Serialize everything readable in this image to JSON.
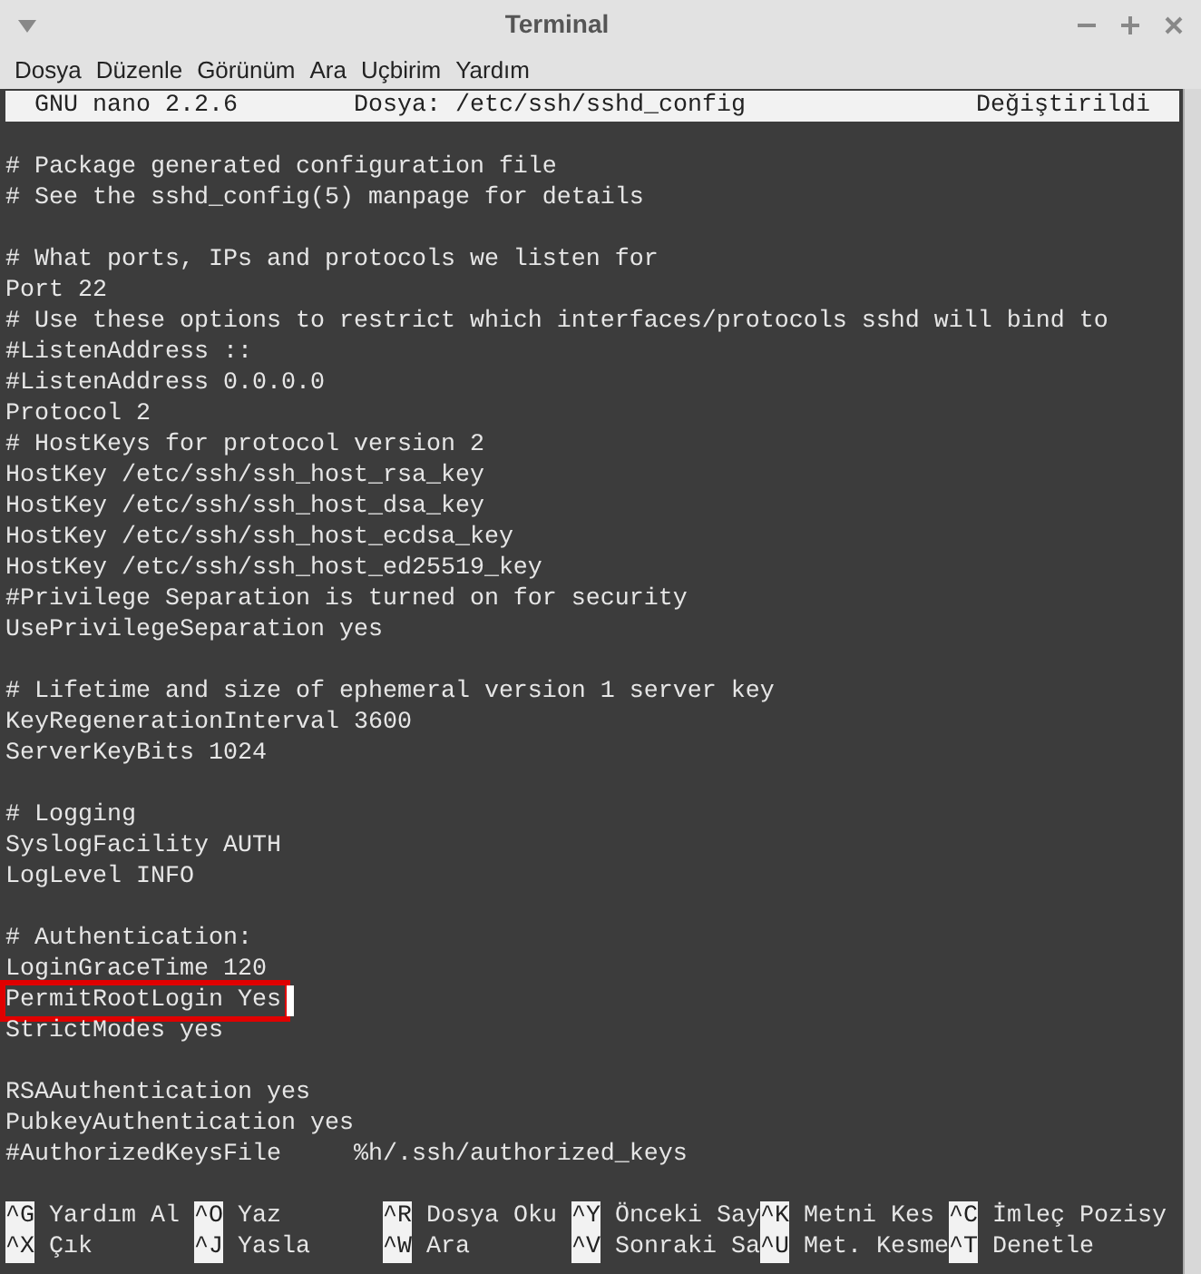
{
  "window": {
    "title": "Terminal"
  },
  "menu": [
    "Dosya",
    "Düzenle",
    "Görünüm",
    "Ara",
    "Uçbirim",
    "Yardım"
  ],
  "nano_header": {
    "version": "GNU nano 2.2.6",
    "file": "Dosya: /etc/ssh/sshd_config",
    "status": "Değiştirildi"
  },
  "lines": [
    {
      "kind": "blank"
    },
    {
      "kind": "text",
      "text": "# Package generated configuration file"
    },
    {
      "kind": "text",
      "text": "# See the sshd_config(5) manpage for details"
    },
    {
      "kind": "blank"
    },
    {
      "kind": "text",
      "text": "# What ports, IPs and protocols we listen for"
    },
    {
      "kind": "text",
      "text": "Port 22"
    },
    {
      "kind": "text",
      "text": "# Use these options to restrict which interfaces/protocols sshd will bind to"
    },
    {
      "kind": "text",
      "text": "#ListenAddress ::"
    },
    {
      "kind": "text",
      "text": "#ListenAddress 0.0.0.0"
    },
    {
      "kind": "text",
      "text": "Protocol 2"
    },
    {
      "kind": "text",
      "text": "# HostKeys for protocol version 2"
    },
    {
      "kind": "text",
      "text": "HostKey /etc/ssh/ssh_host_rsa_key"
    },
    {
      "kind": "text",
      "text": "HostKey /etc/ssh/ssh_host_dsa_key"
    },
    {
      "kind": "text",
      "text": "HostKey /etc/ssh/ssh_host_ecdsa_key"
    },
    {
      "kind": "text",
      "text": "HostKey /etc/ssh/ssh_host_ed25519_key"
    },
    {
      "kind": "text",
      "text": "#Privilege Separation is turned on for security"
    },
    {
      "kind": "text",
      "text": "UsePrivilegeSeparation yes"
    },
    {
      "kind": "blank"
    },
    {
      "kind": "text",
      "text": "# Lifetime and size of ephemeral version 1 server key"
    },
    {
      "kind": "text",
      "text": "KeyRegenerationInterval 3600"
    },
    {
      "kind": "text",
      "text": "ServerKeyBits 1024"
    },
    {
      "kind": "blank"
    },
    {
      "kind": "text",
      "text": "# Logging"
    },
    {
      "kind": "text",
      "text": "SyslogFacility AUTH"
    },
    {
      "kind": "text",
      "text": "LogLevel INFO"
    },
    {
      "kind": "blank"
    },
    {
      "kind": "text",
      "text": "# Authentication:"
    },
    {
      "kind": "text",
      "text": "LoginGraceTime 120"
    },
    {
      "kind": "marked",
      "text": "PermitRootLogin Yes"
    },
    {
      "kind": "text",
      "text": "StrictModes yes"
    },
    {
      "kind": "blank"
    },
    {
      "kind": "text",
      "text": "RSAAuthentication yes"
    },
    {
      "kind": "text",
      "text": "PubkeyAuthentication yes"
    },
    {
      "kind": "text",
      "text": "#AuthorizedKeysFile     %h/.ssh/authorized_keys"
    },
    {
      "kind": "blank"
    }
  ],
  "shortcuts": [
    [
      {
        "key": "^G",
        "label": "Yardım Al"
      },
      {
        "key": "^O",
        "label": "Yaz"
      },
      {
        "key": "^R",
        "label": "Dosya Oku"
      },
      {
        "key": "^Y",
        "label": "Önceki Say"
      },
      {
        "key": "^K",
        "label": "Metni Kes"
      },
      {
        "key": "^C",
        "label": "İmleç Pozisy"
      }
    ],
    [
      {
        "key": "^X",
        "label": "Çık"
      },
      {
        "key": "^J",
        "label": "Yasla"
      },
      {
        "key": "^W",
        "label": "Ara"
      },
      {
        "key": "^V",
        "label": "Sonraki Sa"
      },
      {
        "key": "^U",
        "label": "Met. Kesme"
      },
      {
        "key": "^T",
        "label": "Denetle"
      }
    ]
  ]
}
